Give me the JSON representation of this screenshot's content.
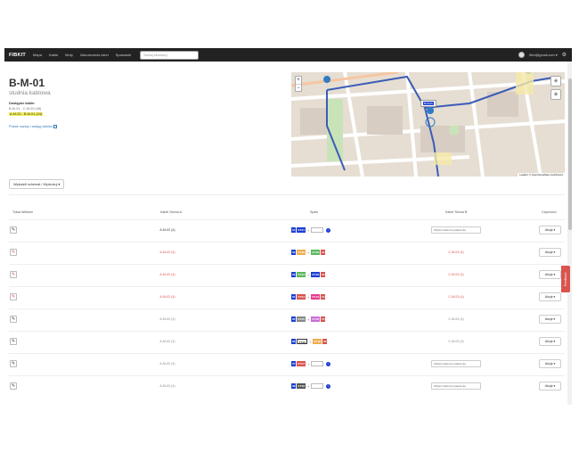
{
  "navbar": {
    "brand": "FIBKIT",
    "links": [
      "Mapa",
      "Kable",
      "Mufy",
      "Zakończenia sieci",
      "Spawanie"
    ],
    "search_placeholder": "Szukaj lokalizacji",
    "user_email": "fibrd@gmail.com ▾",
    "gear": "⚙"
  },
  "header": {
    "title": "B-M-01",
    "subtitle": "studnia kablowa",
    "cables_heading": "Dostępne kable:",
    "cable_1": "B-M-01 - C-M-03 (48)",
    "cable_2": "A-M-02 - B-M-01 (24)",
    "show_link": "Pokaż nazwę i zasięg widoku"
  },
  "map": {
    "zoom_in": "+",
    "zoom_out": "−",
    "marker_label": "B-M-01",
    "attribution": "Leaflet | © OpenStreetMap contributors",
    "colors": {
      "road_blue": "#3b5cb8",
      "marker": "#2f7cc4"
    }
  },
  "scheme_button": "Wyświetl schemat / Wydrukuj ▾",
  "table": {
    "headers": [
      "Trasa Włókien",
      "Kabel Strona A",
      "Spaw",
      "Kabel Strona B",
      "Czynności"
    ],
    "select_placeholder": "Wybierz kabel do połączenia",
    "action_label": "Akcja ▾",
    "rows": [
      {
        "a": "A-M-02 (4)",
        "a_color": "#333333",
        "b": "",
        "b_color": "#333333",
        "pen_color": "#333333",
        "tags": [
          {
            "t": "01",
            "c": "#1d3fd2"
          },
          {
            "t": "ST.01",
            "c": "#1d3fd2"
          }
        ],
        "second": [],
        "open": true
      },
      {
        "a": "A-M-02 (4)",
        "a_color": "#d9534f",
        "b": "C-M-03 (4)",
        "b_color": "#d9534f",
        "pen_color": "#d9534f",
        "tags": [
          {
            "t": "02",
            "c": "#1d3fd2"
          },
          {
            "t": "ST.02",
            "c": "#f0ad4e"
          }
        ],
        "second": [
          {
            "t": "ST.02",
            "c": "#5cb85c"
          },
          {
            "t": "02",
            "c": "#d9534f"
          }
        ],
        "open": false
      },
      {
        "a": "A-M-02 (4)",
        "a_color": "#d9534f",
        "b": "C-M-03 (4)",
        "b_color": "#d9534f",
        "pen_color": "#d9534f",
        "tags": [
          {
            "t": "03",
            "c": "#1d3fd2"
          },
          {
            "t": "ST.03",
            "c": "#5cb85c"
          }
        ],
        "second": [
          {
            "t": "ST.03",
            "c": "#1d3fd2"
          },
          {
            "t": "03",
            "c": "#d9534f"
          }
        ],
        "open": false
      },
      {
        "a": "A-M-02 (4)",
        "a_color": "#d9534f",
        "b": "C-M-03 (4)",
        "b_color": "#d9534f",
        "pen_color": "#d9534f",
        "tags": [
          {
            "t": "04",
            "c": "#1d3fd2"
          },
          {
            "t": "ST.04",
            "c": "#d9534f"
          }
        ],
        "second": [
          {
            "t": "ST.04",
            "c": "#e83e8c"
          },
          {
            "t": "04",
            "c": "#d9534f"
          }
        ],
        "open": false
      },
      {
        "a": "A-M-02 (4)",
        "a_color": "#888888",
        "b": "C-M-03 (4)",
        "b_color": "#888888",
        "pen_color": "#333333",
        "tags": [
          {
            "t": "05",
            "c": "#1d3fd2"
          },
          {
            "t": "ST.05",
            "c": "#888888"
          }
        ],
        "second": [
          {
            "t": "ST.05",
            "c": "#c86dd7"
          },
          {
            "t": "05",
            "c": "#d9534f"
          }
        ],
        "open": false
      },
      {
        "a": "A-M-02 (4)",
        "a_color": "#888888",
        "b": "C-M-03 (4)",
        "b_color": "#888888",
        "pen_color": "#333333",
        "tags": [
          {
            "t": "06",
            "c": "#1d3fd2"
          },
          {
            "t": "ST.06",
            "c": "#ffffff"
          }
        ],
        "second": [
          {
            "t": "ST.06",
            "c": "#f0ad4e"
          },
          {
            "t": "06",
            "c": "#d9534f"
          }
        ],
        "open": false
      },
      {
        "a": "A-M-02 (4)",
        "a_color": "#888888",
        "b": "",
        "b_color": "#888888",
        "pen_color": "#333333",
        "tags": [
          {
            "t": "07",
            "c": "#1d3fd2"
          },
          {
            "t": "ST.07",
            "c": "#d9534f"
          }
        ],
        "second": [],
        "open": true
      },
      {
        "a": "A-M-02 (4)",
        "a_color": "#888888",
        "b": "",
        "b_color": "#888888",
        "pen_color": "#333333",
        "tags": [
          {
            "t": "08",
            "c": "#1d3fd2"
          },
          {
            "t": "ST.08",
            "c": "#555555"
          }
        ],
        "second": [],
        "open": true
      }
    ]
  },
  "feedback": "Feedback"
}
